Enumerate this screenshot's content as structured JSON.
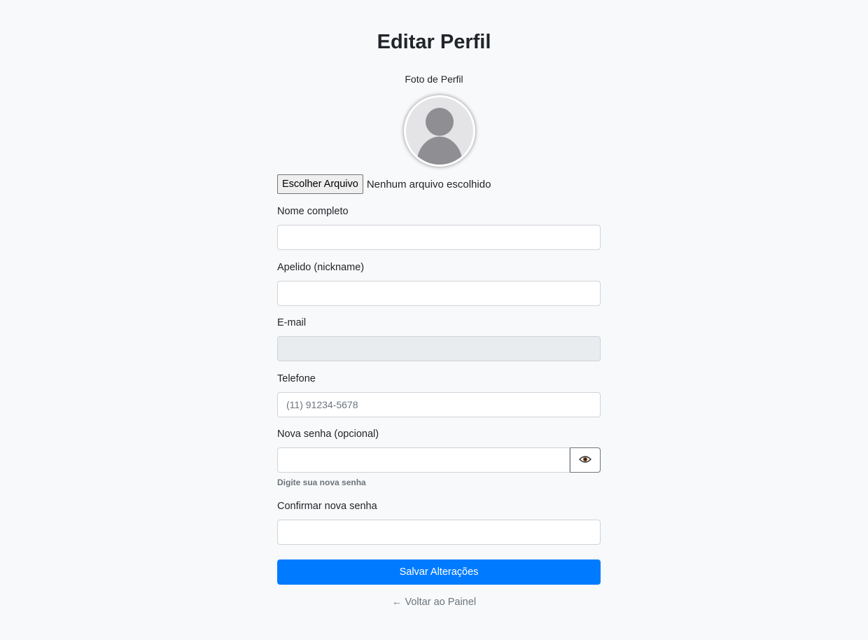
{
  "page": {
    "title": "Editar Perfil",
    "photo_label": "Foto de Perfil"
  },
  "file_input": {
    "button_label": "Escolher Arquivo",
    "status": "Nenhum arquivo escolhido"
  },
  "fields": {
    "nome": {
      "label": "Nome completo",
      "value": "",
      "placeholder": ""
    },
    "apelido": {
      "label": "Apelido (nickname)",
      "value": "",
      "placeholder": ""
    },
    "email": {
      "label": "E-mail",
      "value": "",
      "placeholder": ""
    },
    "telefone": {
      "label": "Telefone",
      "value": "",
      "placeholder": "(11) 91234-5678"
    },
    "nova_senha": {
      "label": "Nova senha (opcional)",
      "value": "",
      "hint": "Digite sua nova senha"
    },
    "confirmar_senha": {
      "label": "Confirmar nova senha",
      "value": ""
    }
  },
  "actions": {
    "save_label": "Salvar Alterações",
    "back_label": "← Voltar ao Painel"
  },
  "icons": {
    "avatar": "user-silhouette-icon",
    "toggle_password": "eye-icon"
  },
  "colors": {
    "primary": "#007bff",
    "background": "#f8f9fa",
    "muted": "#6c757d",
    "disabled_field": "#e9ecef"
  }
}
